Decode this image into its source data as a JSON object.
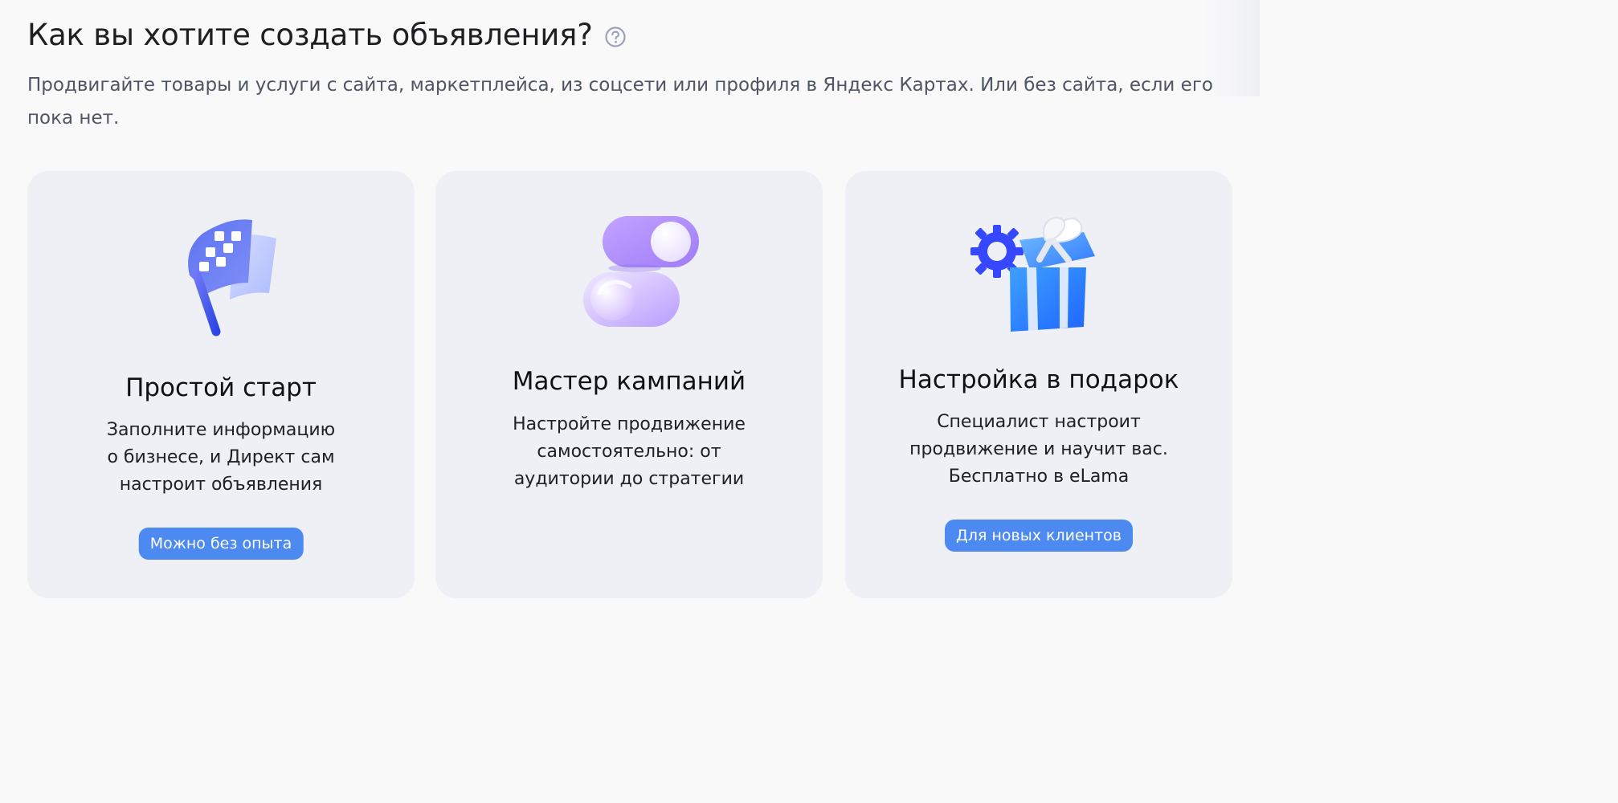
{
  "header": {
    "title": "Как вы хотите создать объявления?",
    "help_icon": "question-circle-icon",
    "subtitle": "Продвигайте товары и услуги с сайта, маркетплейса, из соцсети или профиля в Яндекс Картах. Или без сайта, если его пока нет."
  },
  "cards": [
    {
      "icon": "checkered-flag-icon",
      "title": "Простой старт",
      "description": "Заполните информацию о бизнесе, и Директ сам настроит объявления",
      "badge": "Можно без опыта"
    },
    {
      "icon": "toggle-switches-icon",
      "title": "Мастер кампаний",
      "description": "Настройте продвижение самостоятельно: от аудитории до стратегии",
      "badge": ""
    },
    {
      "icon": "gift-box-icon",
      "title": "Настройка в подарок",
      "description": "Специалист настроит продвижение и научит вас. Бесплатно в eLama",
      "badge": "Для новых клиентов"
    }
  ],
  "colors": {
    "page_background": "#f9f9fa",
    "card_background": "#eef0f5",
    "badge_blue": "#4c8af2",
    "text_main": "#1f1f22",
    "text_secondary": "#4f5563",
    "help_icon": "#9aa3b8"
  }
}
